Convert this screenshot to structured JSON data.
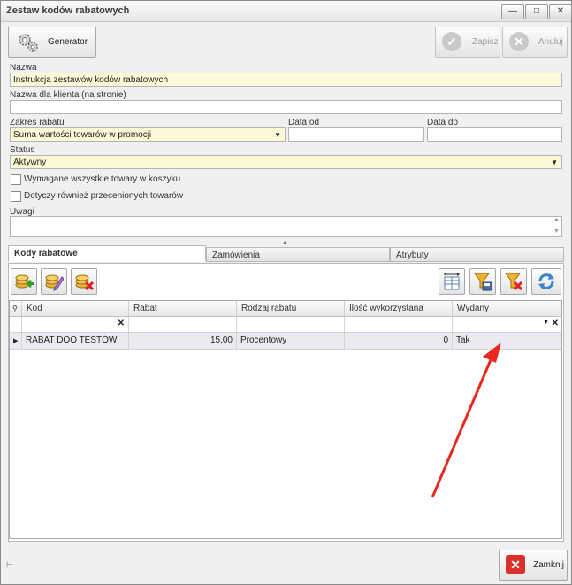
{
  "window": {
    "title": "Zestaw kodów rabatowych",
    "controls": {
      "minimize": "—",
      "maximize": "□",
      "close": "✕"
    }
  },
  "toolbar": {
    "generator_label": "Generator",
    "save_label": "Zapisz",
    "cancel_label": "Anuluj"
  },
  "form": {
    "name_label": "Nazwa",
    "name_value": "Instrukcja zestawów kodów rabatowych",
    "client_name_label": "Nazwa dla klienta (na stronie)",
    "client_name_value": "",
    "range_label": "Zakres rabatu",
    "range_value": "Suma wartości towarów w promocji",
    "date_from_label": "Data od",
    "date_from_value": "",
    "date_to_label": "Data do",
    "date_to_value": "",
    "status_label": "Status",
    "status_value": "Aktywny",
    "chk_all_items_label": "Wymagane wszystkie towary w koszyku",
    "chk_all_items_checked": false,
    "chk_discounted_label": "Dotyczy również przecenionych towarów",
    "chk_discounted_checked": false,
    "notes_label": "Uwagi",
    "notes_value": ""
  },
  "tabs": [
    {
      "label": "Kody rabatowe",
      "active": true
    },
    {
      "label": "Zamówienia",
      "active": false
    },
    {
      "label": "Atrybuty",
      "active": false
    }
  ],
  "grid": {
    "columns": [
      "Kod",
      "Rabat",
      "Rodzaj rabatu",
      "Ilość wykorzystana",
      "Wydany"
    ],
    "rows": [
      {
        "kod": "RABAT DOO TESTÓW",
        "rabat": "15,00",
        "rodzaj": "Procentowy",
        "ilosc": "0",
        "wydany": "Tak"
      }
    ]
  },
  "footer": {
    "close_label": "Zamknij"
  },
  "colors": {
    "required_field": "#fdf8d6",
    "annotation_arrow": "#e8281e",
    "close_icon": "#d9312a"
  }
}
